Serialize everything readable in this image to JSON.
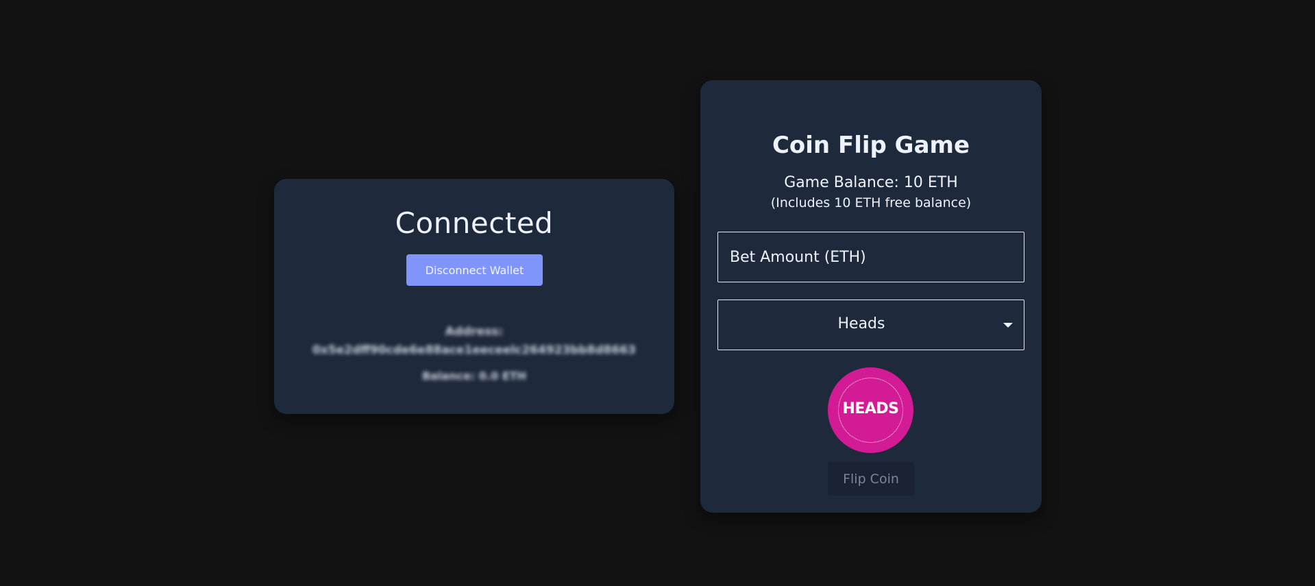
{
  "wallet": {
    "status": "Connected",
    "disconnect_label": "Disconnect Wallet",
    "address_label": "Address:",
    "address_value": "0x5e2dff90cde6e88ace1eeceelc264923bb8d8663",
    "balance_text": "Balance: 0.0 ETH"
  },
  "game": {
    "title": "Coin Flip Game",
    "balance_text": "Game Balance: 10 ETH",
    "free_balance_text": "(Includes 10 ETH free balance)",
    "bet_placeholder": "Bet Amount (ETH)",
    "side_selected": "Heads",
    "coin_label": "HEADS",
    "flip_label": "Flip Coin"
  },
  "colors": {
    "background": "#121212",
    "card": "#1e293b",
    "accent_button": "#7f95fb",
    "coin": "#d31b95"
  }
}
